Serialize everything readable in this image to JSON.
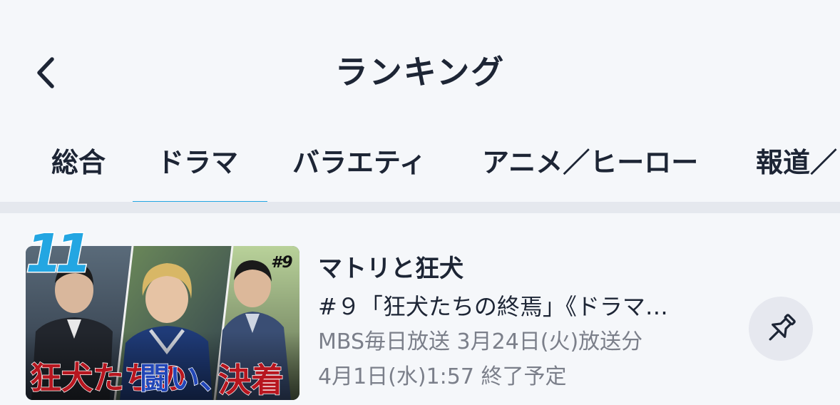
{
  "header": {
    "title": "ランキング",
    "back_icon": "chevron-left-icon"
  },
  "tabs": [
    {
      "label": "総合",
      "selected": false
    },
    {
      "label": "ドラマ",
      "selected": true
    },
    {
      "label": "バラエティ",
      "selected": false
    },
    {
      "label": "アニメ／ヒーロー",
      "selected": false
    },
    {
      "label": "報道／",
      "selected": false
    }
  ],
  "accent_color": "#23a6e2",
  "items": [
    {
      "rank": "11",
      "title": "マトリと狂犬",
      "subtitle": "#９「狂犬たちの終焉」《ドラマ…",
      "broadcast": "MBS毎日放送 3月24日(火)放送分",
      "expiry": "4月1日(水)1:57 終了予定",
      "thumbnail": {
        "episode_badge": "#9",
        "caption_1": "狂犬たちの",
        "caption_2": "闘い、",
        "caption_3": "決着"
      },
      "pin_icon": "pin-icon"
    }
  ]
}
